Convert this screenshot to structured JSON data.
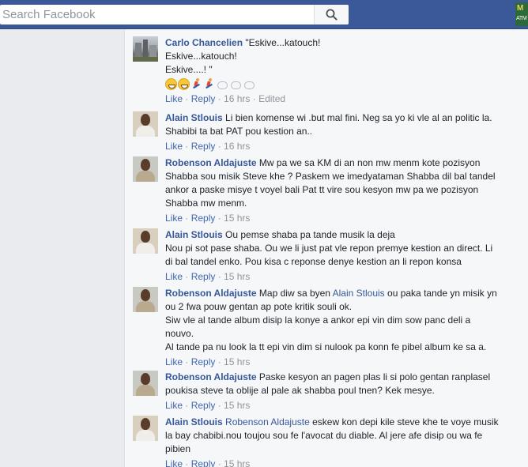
{
  "search": {
    "placeholder": "Search Facebook"
  },
  "corner_logo": {
    "top_text": "M",
    "bottom_text": "ATM"
  },
  "colors": {
    "topbar": "#3b5998",
    "link": "#4267b2",
    "author": "#365899",
    "meta": "#90949c"
  },
  "comments": [
    {
      "author": "Carlo Chancelien",
      "mention": "",
      "lines": [
        "\"Eskive...katouch!",
        "Eskive...katouch!",
        "Eskive....! \""
      ],
      "emojis": [
        "grin-emoji",
        "grin-emoji",
        "runner-emoji",
        "runner-emoji",
        "dash-emoji",
        "dash-emoji",
        "dash-emoji"
      ],
      "like": "Like",
      "reply": "Reply",
      "time": "16 hrs",
      "edited": "Edited"
    },
    {
      "author": "Alain Stlouis",
      "mention": "",
      "lines": [
        "Li bien komense wi .but mal fini. Neg sa yo ki vle al an politic la.",
        "Shabibi ta bat PAT pou kestion an.."
      ],
      "like": "Like",
      "reply": "Reply",
      "time": "16 hrs"
    },
    {
      "author": "Robenson Aldajuste",
      "mention": "",
      "lines": [
        "Mw pa we sa KM di an non mw menm kote pozisyon",
        "Shabba sou misik Steve khe ? Paskem we imedyataman Shabba dil bal tandel",
        "ankor a paske misye t voyel bali Pat tt vire sou kesyon mw pa we pozisyon",
        "Shabba mw menm."
      ],
      "like": "Like",
      "reply": "Reply",
      "time": "15 hrs"
    },
    {
      "author": "Alain Stlouis",
      "mention": "",
      "lines": [
        "Ou pemse shaba pa tande musik la deja",
        "Nou pi sot pase shaba. Ou we li just pat vle repon premye kestion an direct. Li",
        "di bal tandel enko. Pou kisa c reponse denye kestion an li repon konsa"
      ],
      "like": "Like",
      "reply": "Reply",
      "time": "15 hrs"
    },
    {
      "author": "Robenson Aldajuste",
      "mention": "Alain Stlouis",
      "lines": [
        "Map diw sa byen",
        "ou paka tande yn misik yn",
        "ou 2 fwa pouw gentan ap pote kritik souli ok.",
        "Siw vle al tande album disip la konye a ankor epi vin dim sow panc deli a",
        "nouvo.",
        "Al tande pa nu look la tt epi vin dim si nulook pa konn fe pibel album ke sa a."
      ],
      "like": "Like",
      "reply": "Reply",
      "time": "15 hrs"
    },
    {
      "author": "Robenson Aldajuste",
      "mention": "",
      "lines": [
        "Paske kesyon an pagen plas li si polo gentan ranplasel",
        "poukisa steve ta oblije al pale ak shabba poul tnen? Kek mesye."
      ],
      "like": "Like",
      "reply": "Reply",
      "time": "15 hrs"
    },
    {
      "author": "Alain Stlouis",
      "mention": "Robenson Aldajuste",
      "lines": [
        "eskew kon depi kile steve khe te voye musik",
        "la bay chabibi.nou toujou sou fe l'avocat du diable. Al jere afe disip ou wa fe",
        "pibien"
      ],
      "like": "Like",
      "reply": "Reply",
      "time": "15 hrs"
    }
  ]
}
